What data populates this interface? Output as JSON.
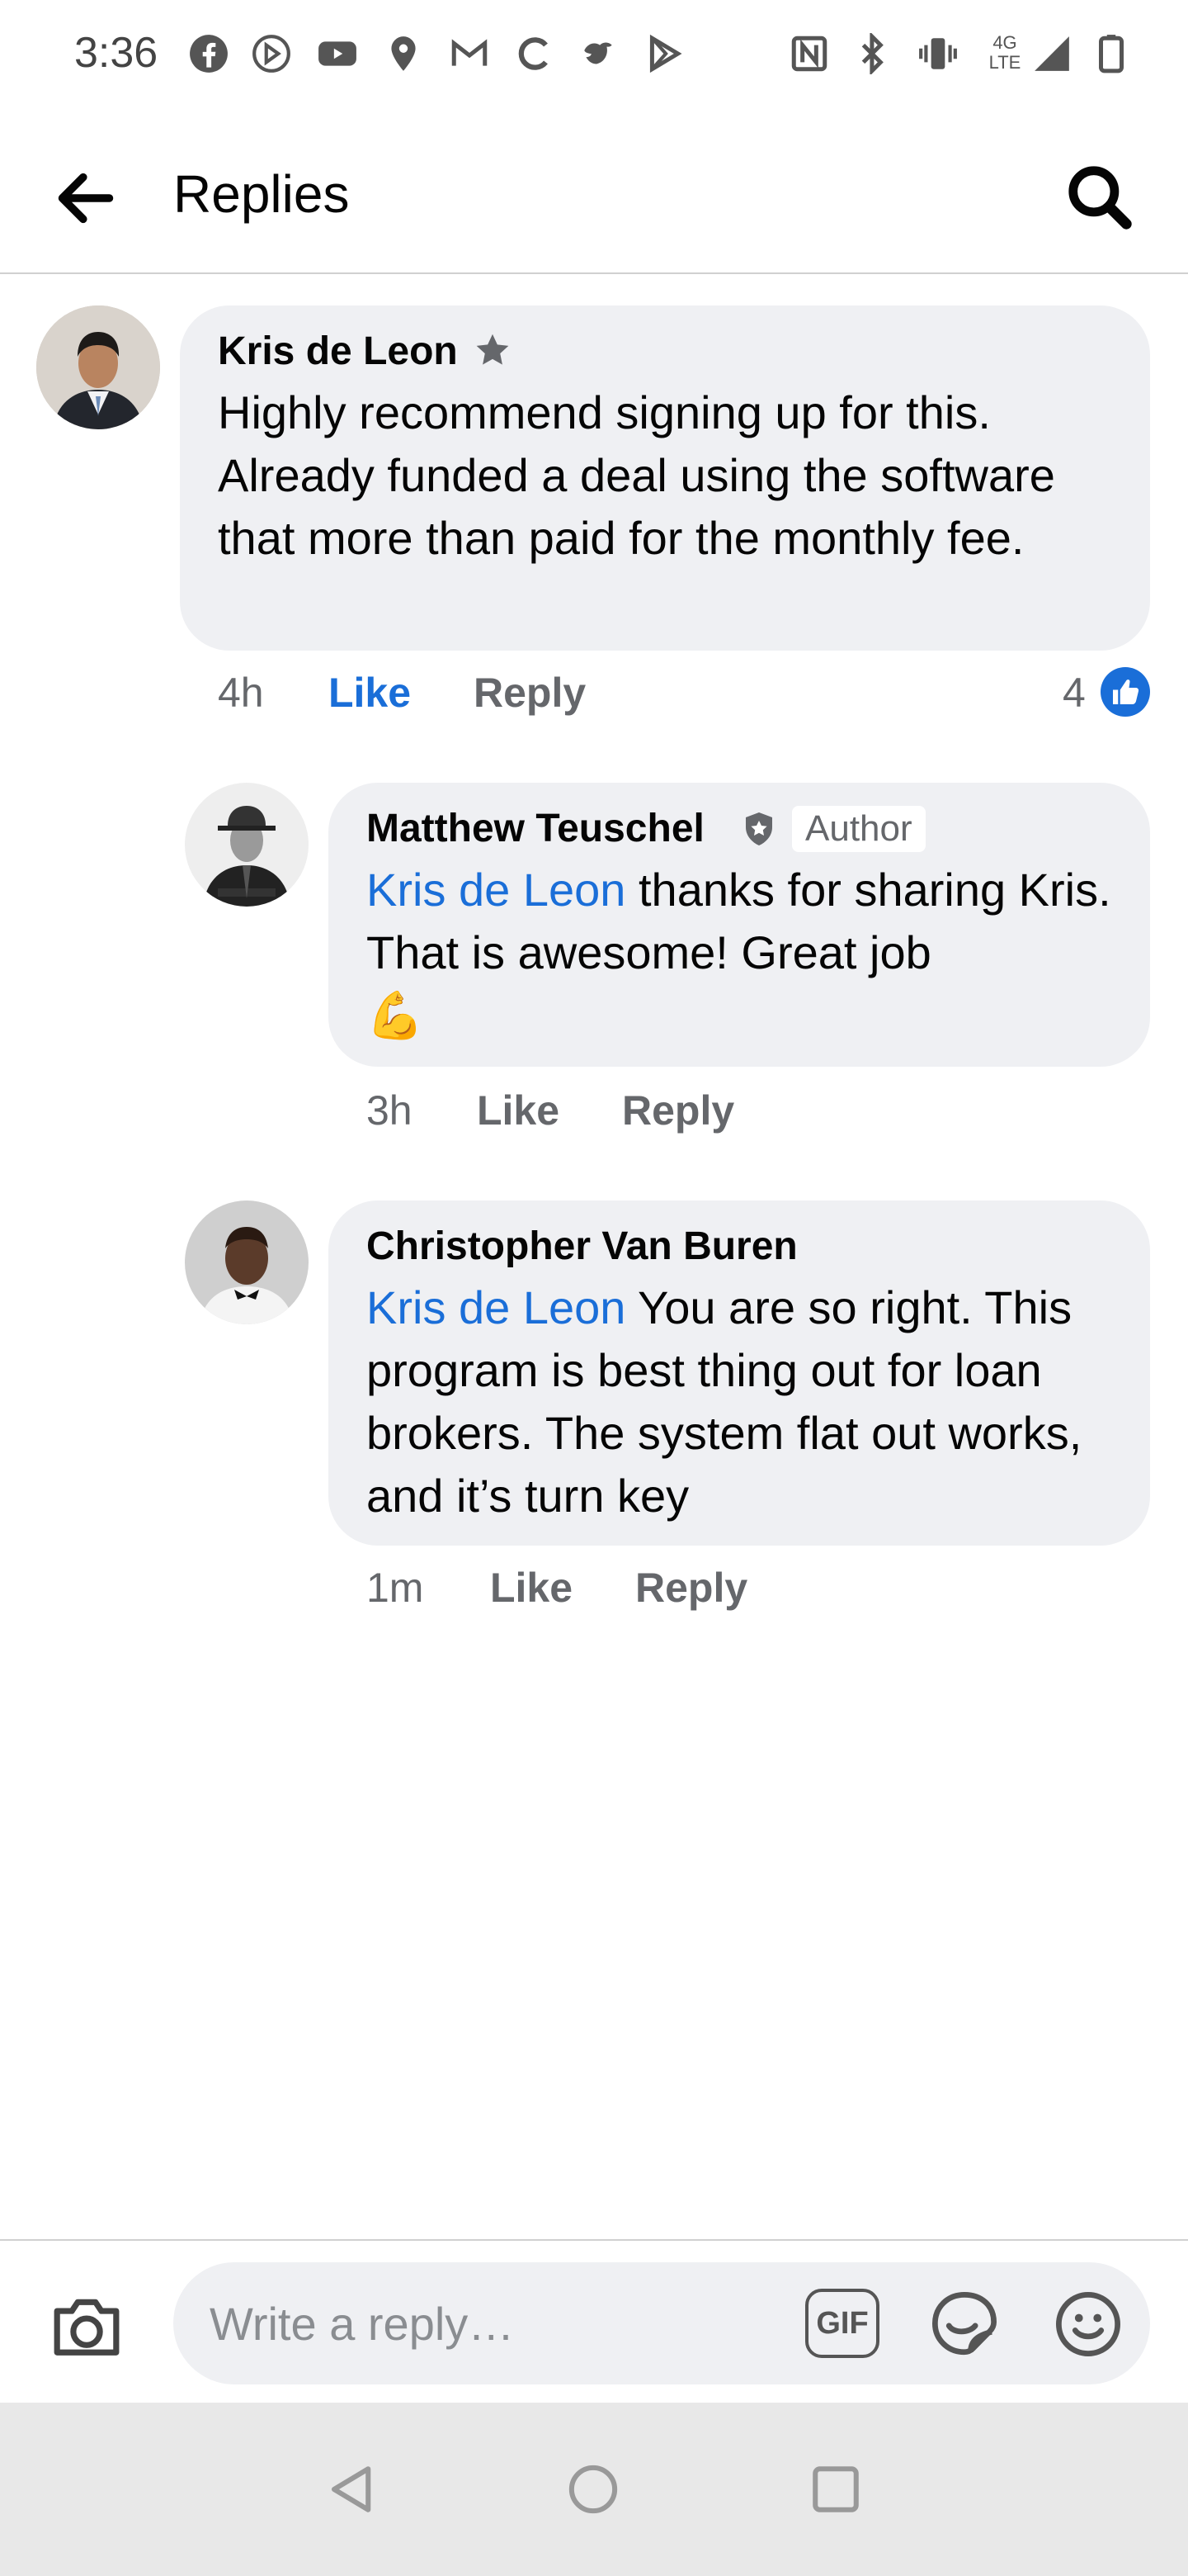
{
  "status_bar": {
    "time": "3:36",
    "network": "4G LTE",
    "icons": [
      "facebook-icon",
      "pinterest-icon",
      "youtube-icon",
      "location-icon",
      "gmail-icon",
      "c-app-icon",
      "bird-icon",
      "play-icon",
      "nfc-icon",
      "bluetooth-icon",
      "vibrate-icon",
      "signal-icon",
      "battery-icon"
    ]
  },
  "header": {
    "title": "Replies",
    "back_icon": "back-arrow-icon",
    "search_icon": "search-icon"
  },
  "comments": [
    {
      "author": "Kris de Leon",
      "badge_icon": "top-fan-star-icon",
      "text": "Highly recommend signing up for this. Already funded a deal using the software that more than paid for the monthly fee.",
      "time": "4h",
      "like_label": "Like",
      "like_state": "liked",
      "reply_label": "Reply",
      "reaction_count": "4",
      "reaction_icon": "thumbs-up-reaction-icon"
    },
    {
      "author": "Matthew Teuschel",
      "badge_icon": "shield-badge-icon",
      "author_badge": "Author",
      "mention": "Kris de Leon",
      "text": " thanks for sharing Kris. That is awesome! Great job",
      "emoji": "💪",
      "time": "3h",
      "like_label": "Like",
      "reply_label": "Reply"
    },
    {
      "author": "Christopher Van Buren",
      "mention": "Kris de Leon",
      "text": " You are so right. This program is best thing out for loan brokers. The system flat out works, and it’s turn key",
      "time": "1m",
      "like_label": "Like",
      "reply_label": "Reply"
    }
  ],
  "compose": {
    "placeholder": "Write a reply…",
    "camera_icon": "camera-icon",
    "gif_label": "GIF",
    "sticker_icon": "sticker-icon",
    "emoji_icon": "emoji-icon"
  },
  "nav_bar": {
    "icons": [
      "back-nav-icon",
      "home-nav-icon",
      "recents-nav-icon"
    ]
  },
  "colors": {
    "accent": "#1a6ed8",
    "bubble": "#eff0f3",
    "secondary_text": "#65676b"
  }
}
